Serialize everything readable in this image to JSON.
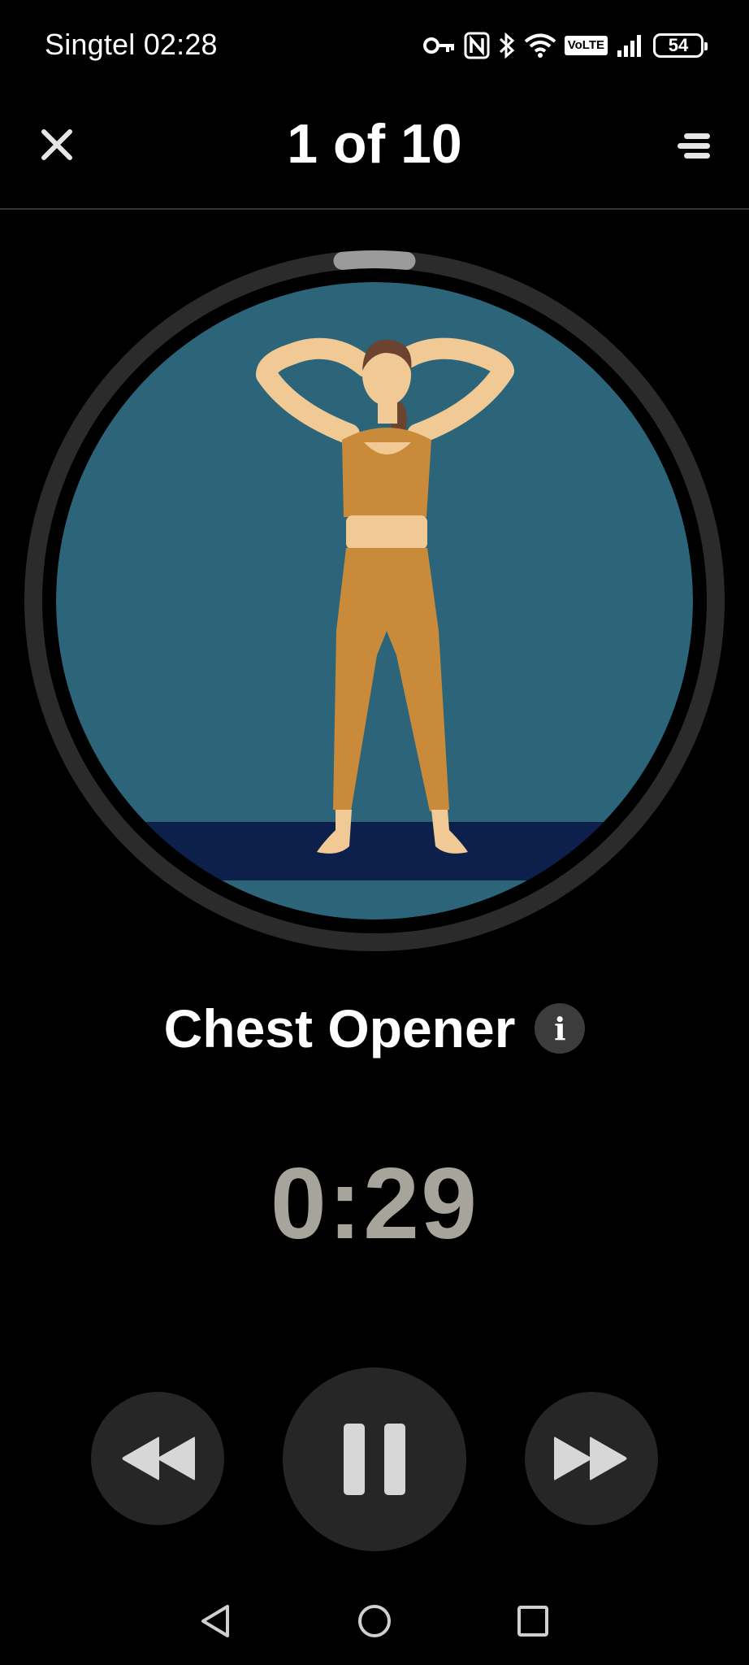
{
  "status_bar": {
    "carrier": "Singtel",
    "time": "02:28",
    "volte_label": "VoLTE",
    "battery_level": "54",
    "icons": [
      "key-icon",
      "nfc-icon",
      "bluetooth-icon",
      "wifi-icon",
      "volte-icon",
      "signal-icon",
      "battery-icon"
    ]
  },
  "header": {
    "title": "1 of 10",
    "close_icon": "close-icon",
    "menu_icon": "menu-icon"
  },
  "exercise": {
    "name": "Chest Opener",
    "info_label": "i",
    "progress_fraction": 0.03,
    "colors": {
      "background": "#2c6479",
      "mat": "#0d1f4b",
      "skin": "#f0c995",
      "outfit": "#c98b3a",
      "hair": "#6b4330",
      "ring_track": "#2b2b2b",
      "ring_progress": "#9b9b9b"
    }
  },
  "timer": {
    "remaining": "0:29",
    "color": "#a7a49c"
  },
  "controls": {
    "previous_icon": "rewind-icon",
    "pause_icon": "pause-icon",
    "next_icon": "fast-forward-icon",
    "button_color": "#262626",
    "icon_color": "#d7d7d7"
  },
  "nav_bar": {
    "back_icon": "back-triangle-icon",
    "home_icon": "home-circle-icon",
    "recent_icon": "recent-square-icon"
  }
}
